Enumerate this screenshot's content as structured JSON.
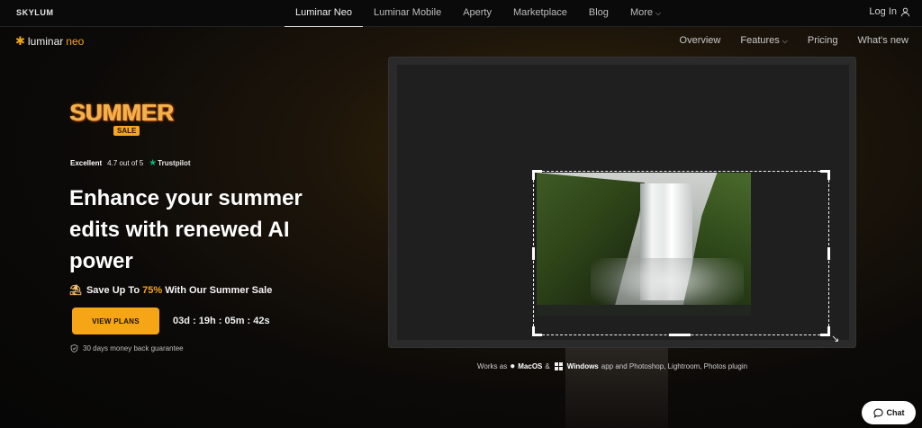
{
  "topbar": {
    "brand": "SKYLUM",
    "tabs": [
      {
        "label": "Luminar Neo",
        "active": true
      },
      {
        "label": "Luminar Mobile",
        "active": false
      },
      {
        "label": "Aperty",
        "active": false
      },
      {
        "label": "Marketplace",
        "active": false
      },
      {
        "label": "Blog",
        "active": false
      },
      {
        "label": "More",
        "active": false
      }
    ],
    "login": "Log In",
    "login_icon": "user-icon"
  },
  "productbar": {
    "logo_word": "luminar",
    "logo_suffix": "neo",
    "logo_icon": "sparkle-icon",
    "items": [
      {
        "label": "Overview"
      },
      {
        "label": "Features"
      },
      {
        "label": "Pricing"
      },
      {
        "label": "What's new"
      }
    ]
  },
  "hero": {
    "sale_word": "SUMMER",
    "sale_tag": "SALE",
    "rating_excellent": "Excellent",
    "rating_score": "4.7 out of 5",
    "rating_source": "Trustpilot",
    "headline": "Enhance your summer edits with renewed AI power",
    "promo_prefix": "Save Up To ",
    "promo_percent": "75%",
    "promo_suffix": " With Our Summer Sale",
    "cta": "VIEW PLANS",
    "countdown": "03d : 19h : 05m : 42s",
    "guarantee": "30 days money back guarantee",
    "accent_color": "#f5a516"
  },
  "platforms": {
    "prefix": "Works as",
    "mac": "MacOS",
    "amp": "&",
    "windows": "Windows",
    "suffix": "app and Photoshop, Lightroom, Photos plugin"
  },
  "chat": {
    "label": "Chat",
    "icon": "chat-bubble-icon"
  }
}
